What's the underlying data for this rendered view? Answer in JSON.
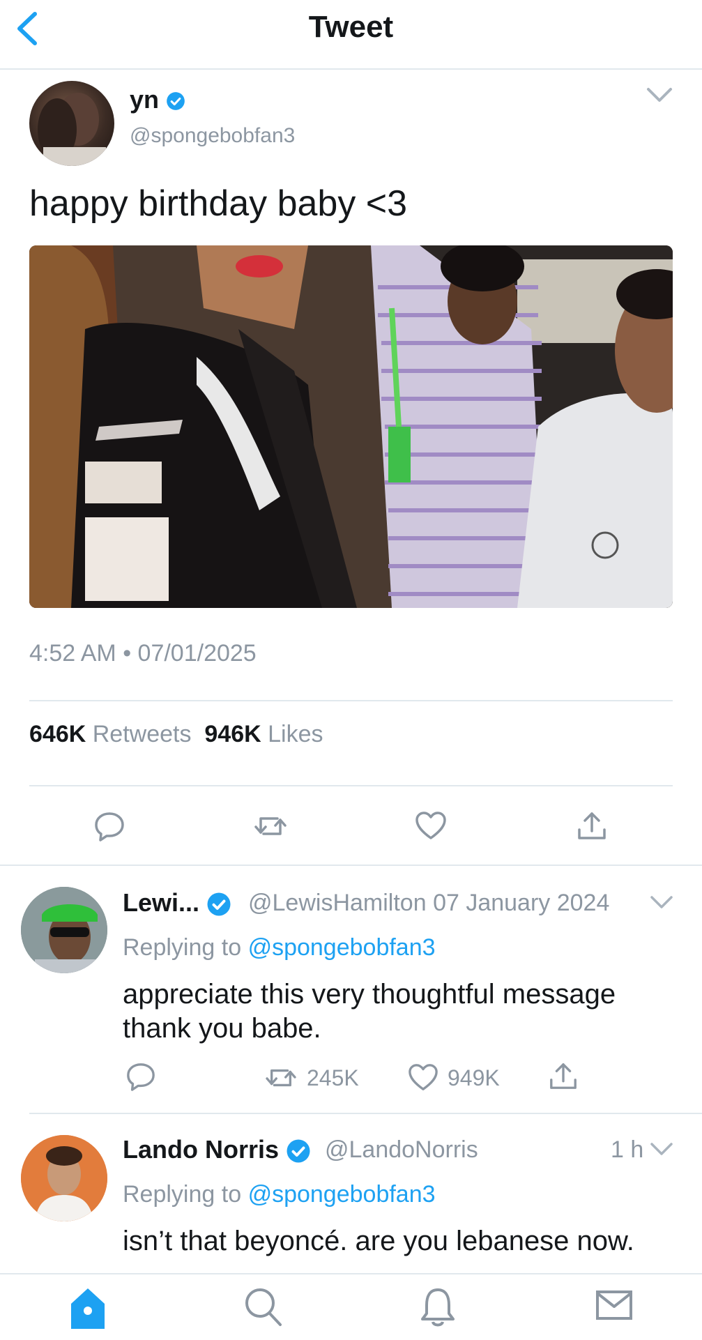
{
  "header": {
    "title": "Tweet"
  },
  "tweet": {
    "author_name": "yn",
    "author_handle": "@spongebobfan3",
    "text": "happy birthday baby <3",
    "time": "4:52 AM",
    "date": "07/01/2025",
    "retweets_count": "646K",
    "retweets_label": "Retweets",
    "likes_count": "946K",
    "likes_label": "Likes"
  },
  "replies": [
    {
      "name": "Lewi...",
      "handle": "@LewisHamilton",
      "time": "07 January 2024",
      "replying_label": "Replying to",
      "mention": "@spongebobfan3",
      "text": "appreciate this very thoughtful message thank you babe.",
      "retweets": "245K",
      "likes": "949K"
    },
    {
      "name": "Lando Norris",
      "handle": "@LandoNorris",
      "time": "1 h",
      "replying_label": "Replying to",
      "mention": "@spongebobfan3",
      "text": "isn’t that beyoncé. are you lebanese now."
    }
  ],
  "icons": {
    "back": "chevron-left-icon",
    "verified": "verified-badge-icon",
    "reply": "reply-icon",
    "retweet": "retweet-icon",
    "like": "heart-icon",
    "share": "share-icon",
    "tabs": [
      "home-icon",
      "search-icon",
      "bell-icon",
      "mail-icon"
    ]
  },
  "colors": {
    "accent": "#1da1f2",
    "muted": "#8c96a1",
    "text": "#14171a",
    "border": "#e1e8ed"
  }
}
